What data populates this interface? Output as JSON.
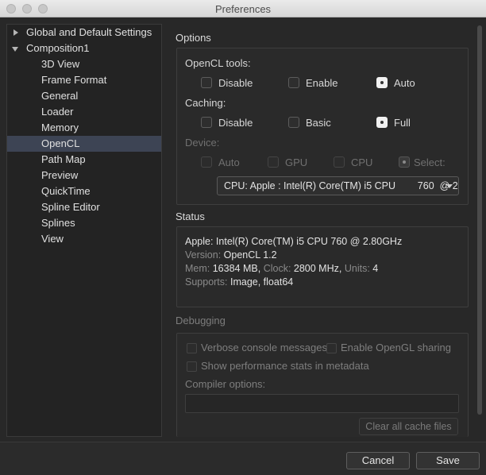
{
  "window": {
    "title": "Preferences"
  },
  "sidebar": {
    "items": [
      {
        "label": "Global and Default Settings",
        "level": 0,
        "expanded": false
      },
      {
        "label": "Composition1",
        "level": 0,
        "expanded": true
      },
      {
        "label": "3D View",
        "level": 1
      },
      {
        "label": "Frame Format",
        "level": 1
      },
      {
        "label": "General",
        "level": 1
      },
      {
        "label": "Loader",
        "level": 1
      },
      {
        "label": "Memory",
        "level": 1
      },
      {
        "label": "OpenCL",
        "level": 1,
        "selected": true
      },
      {
        "label": "Path Map",
        "level": 1
      },
      {
        "label": "Preview",
        "level": 1
      },
      {
        "label": "QuickTime",
        "level": 1
      },
      {
        "label": "Spline Editor",
        "level": 1
      },
      {
        "label": "Splines",
        "level": 1
      },
      {
        "label": "View",
        "level": 1
      }
    ]
  },
  "options": {
    "section_title": "Options",
    "opencl_tools": {
      "label": "OpenCL tools:",
      "choices": [
        "Disable",
        "Enable",
        "Auto"
      ],
      "selected": "Auto"
    },
    "caching": {
      "label": "Caching:",
      "choices": [
        "Disable",
        "Basic",
        "Full"
      ],
      "selected": "Full"
    },
    "device": {
      "label": "Device:",
      "choices": [
        "Auto",
        "GPU",
        "CPU",
        "Select:"
      ],
      "selected": "Select:",
      "select_value": "CPU: Apple : Intel(R) Core(TM) i5 CPU        760  @ 2"
    }
  },
  "status": {
    "section_title": "Status",
    "device_line": "Apple: Intel(R) Core(TM) i5 CPU 760 @ 2.80GHz",
    "version_key": "Version:",
    "version_val": "OpenCL 1.2",
    "mem_key": "Mem:",
    "mem_val": "16384 MB,",
    "clock_key": "Clock:",
    "clock_val": "2800 MHz,",
    "units_key": "Units:",
    "units_val": "4",
    "supports_key": "Supports:",
    "supports_val": "Image, float64"
  },
  "debugging": {
    "section_title": "Debugging",
    "verbose_label": "Verbose console messages",
    "opengl_sharing_label": "Enable OpenGL sharing",
    "perf_stats_label": "Show performance stats in metadata",
    "compiler_label": "Compiler options:",
    "compiler_value": "",
    "clear_cache_label": "Clear all cache files"
  },
  "buttons": {
    "cancel": "Cancel",
    "save": "Save"
  },
  "colors": {
    "selection": "#3d4454",
    "background": "#282828"
  }
}
